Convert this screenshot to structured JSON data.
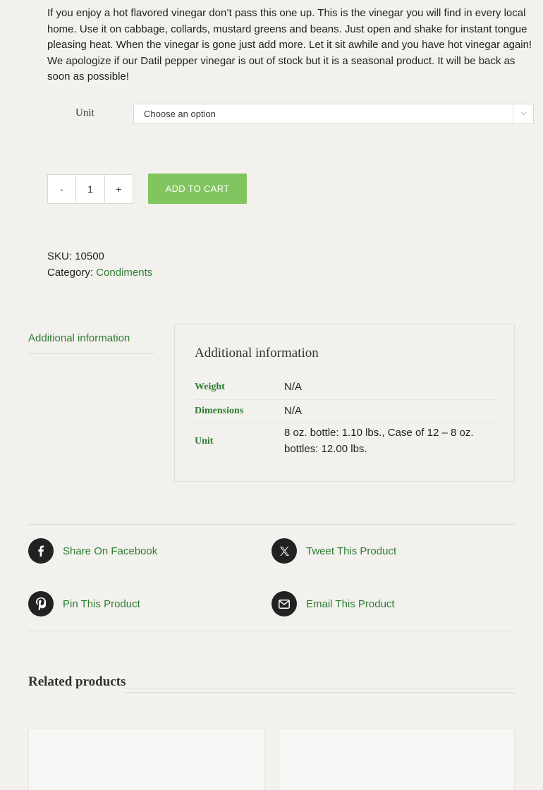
{
  "description": "If you enjoy a hot flavored vinegar don’t pass this one up. This is the vinegar you will find in every local home. Use it on cabbage, collards, mustard greens and beans. Just open and shake for instant tongue pleasing heat. When the vinegar is gone just add more. Let it sit awhile and you have hot vinegar again! We apologize if our Datil pepper vinegar is out of stock but it is a seasonal product. It will be back as soon as possible!",
  "variation": {
    "label": "Unit",
    "selected": "Choose an option"
  },
  "quantity": {
    "minus": "-",
    "value": "1",
    "plus": "+"
  },
  "add_to_cart": "ADD TO CART",
  "meta": {
    "sku_label": "SKU:",
    "sku_value": "10500",
    "category_label": "Category:",
    "category_value": "Condiments"
  },
  "tabs": {
    "active": "Additional information"
  },
  "additional_info": {
    "title": "Additional information",
    "rows": [
      {
        "key": "Weight",
        "value": "N/A"
      },
      {
        "key": "Dimensions",
        "value": "N/A"
      },
      {
        "key": "Unit",
        "value": "8 oz. bottle: 1.10 lbs., Case of 12 – 8 oz. bottles: 12.00 lbs."
      }
    ]
  },
  "share": {
    "facebook": "Share On Facebook",
    "twitter": "Tweet This Product",
    "pinterest": "Pin This Product",
    "email": "Email This Product"
  },
  "related": {
    "title": "Related products"
  },
  "colors": {
    "background": "#f2f1ed",
    "accent_green": "#2e7d32",
    "button_green": "#82c560"
  }
}
